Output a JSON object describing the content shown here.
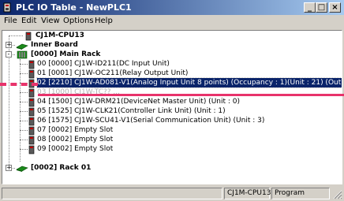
{
  "window": {
    "title": "PLC IO Table - NewPLC1",
    "buttons": {
      "minimize": "_",
      "maximize": "□",
      "close": "×"
    }
  },
  "menu": [
    {
      "label": "File"
    },
    {
      "label": "Edit"
    },
    {
      "label": "View"
    },
    {
      "label": "Options"
    },
    {
      "label": "Help"
    }
  ],
  "tree": {
    "cpu": "CJ1M-CPU13",
    "inner_board": "Inner Board",
    "main_rack": "[0000] Main Rack",
    "slots": [
      "00 [0000] CJ1W-ID211(DC Input Unit)",
      "01 [0001] CJ1W-OC211(Relay Output Unit)",
      "02 [2210] CJ1W-AD081-V1(Analog Input Unit 8 points) (Occupancy : 1)(Unit : 21) (Out: 1, In: 9)",
      "03 [1000] CJ1W-TC?? ...",
      "04 [1500] CJ1W-DRM21(DeviceNet Master Unit) (Unit : 0)",
      "05 [1525] CJ1W-CLK21(Controller Link Unit) (Unit : 1)",
      "06 [1575] CJ1W-SCU41-V1(Serial Communication Unit) (Unit : 3)",
      "07 [0002] Empty Slot",
      "08 [0002] Empty Slot",
      "09 [0002] Empty Slot"
    ],
    "rack01": "[0002] Rack 01",
    "expand_plus": "+",
    "collapse_minus": "-"
  },
  "status": {
    "cpu": "CJ1M-CPU13",
    "mode": "Program"
  },
  "colors": {
    "title_start": "#0a246a",
    "selection": "#0a246a",
    "annotation": "#e8336b"
  },
  "icons": [
    "plc-app-icon",
    "plc-unit-icon",
    "board-icon",
    "rack-icon"
  ]
}
